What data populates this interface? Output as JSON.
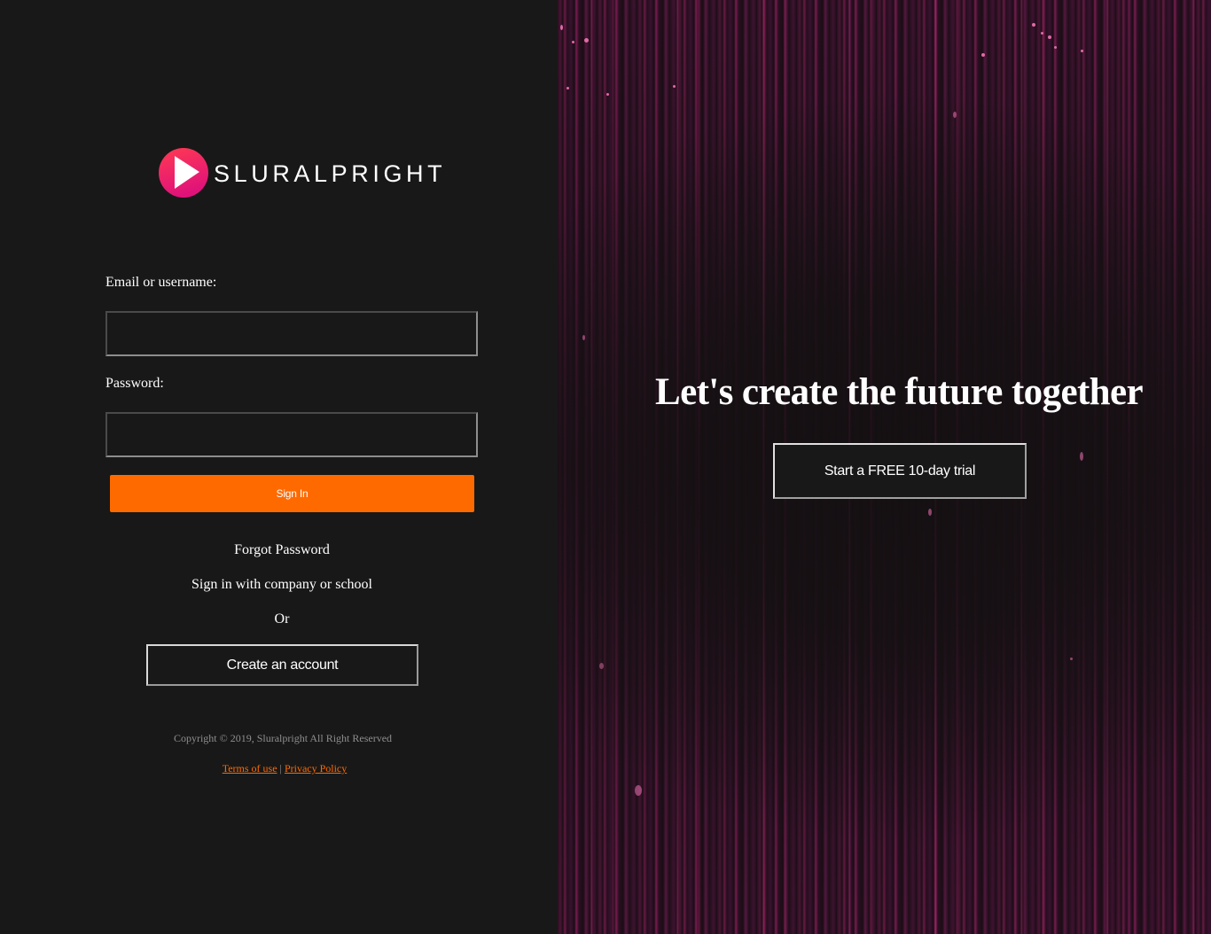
{
  "brand": {
    "name": "SLURALPRIGHT",
    "logo_icon": "play-icon",
    "logo_gradient": [
      "#ff3a5c",
      "#e0127a"
    ]
  },
  "login_form": {
    "email_label": "Email or username:",
    "email_value": "",
    "password_label": "Password:",
    "password_value": "",
    "sign_in_label": "Sign In",
    "forgot_password": "Forgot Password",
    "company_sign_in": "Sign in with company or school",
    "or_text": "Or",
    "create_account_label": "Create an account"
  },
  "footer": {
    "copyright": "Copyright © 2019, Sluralpright All Right Reserved",
    "terms_label": "Terms of use",
    "separator": "|",
    "privacy_label": "Privacy Policy"
  },
  "hero": {
    "tagline": "Let's create the future together",
    "trial_label": "Start a FREE 10-day trial"
  },
  "colors": {
    "background": "#181818",
    "accent": "#ff6a00",
    "hero_streak": "#7a1c50"
  }
}
